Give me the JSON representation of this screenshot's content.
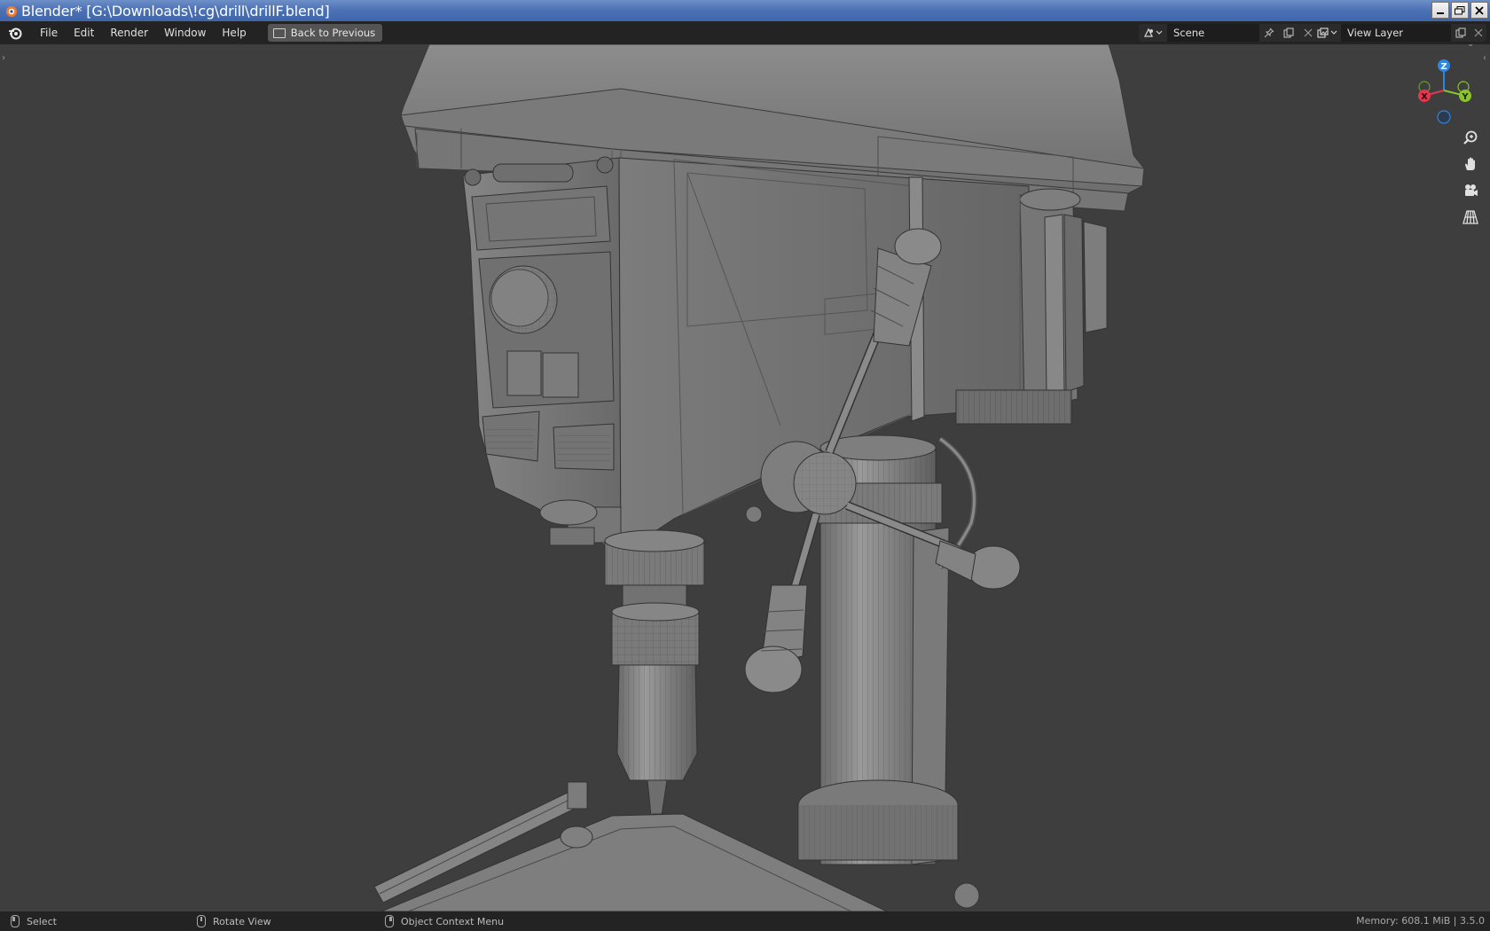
{
  "window": {
    "title": "Blender* [G:\\Downloads\\!cg\\drill\\drillF.blend]",
    "controls": [
      "minimize",
      "restore",
      "close"
    ]
  },
  "menu": {
    "items": [
      "File",
      "Edit",
      "Render",
      "Window",
      "Help"
    ],
    "back_button": "Back to Previous"
  },
  "scene": {
    "name": "Scene"
  },
  "view_layer": {
    "name": "View Layer"
  },
  "gizmo": {
    "x_label": "X",
    "y_label": "Y",
    "z_label": "Z",
    "colors": {
      "x": "#e5374f",
      "y": "#8bc32a",
      "z": "#2e86e0"
    }
  },
  "viewport_nav": [
    "zoom-icon",
    "pan-hand-icon",
    "camera-icon",
    "perspective-grid-icon"
  ],
  "statusbar": {
    "select": "Select",
    "rotate": "Rotate View",
    "context": "Object Context Menu",
    "memory": "Memory: 608.1 MiB | 3.5.0"
  }
}
